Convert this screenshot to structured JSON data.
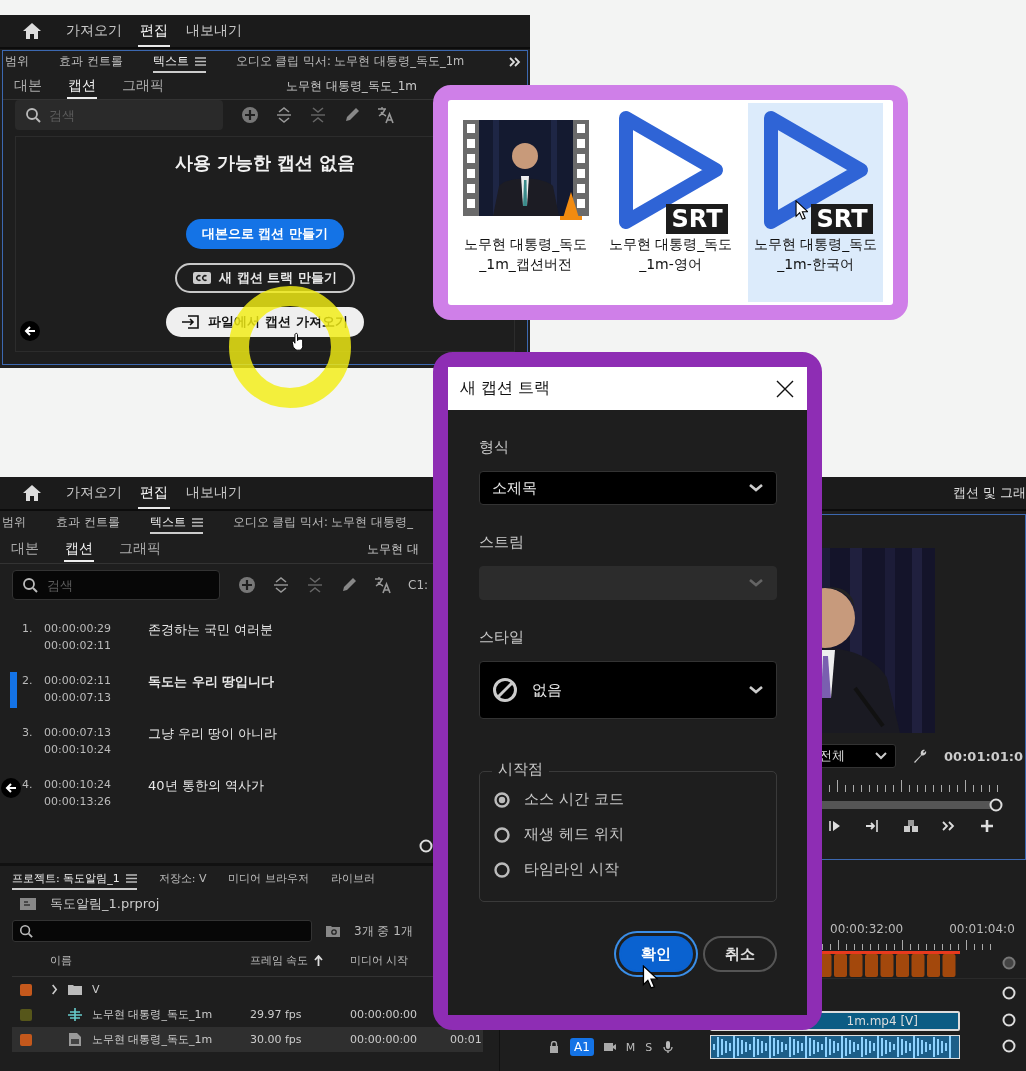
{
  "top_screen": {
    "workspace_tabs": [
      {
        "label": "가져오기",
        "selected": false
      },
      {
        "label": "편집",
        "selected": true
      },
      {
        "label": "내보내기",
        "selected": false
      }
    ],
    "panel_tabs": [
      {
        "label": "범위",
        "selected": false,
        "menu": false
      },
      {
        "label": "효과 컨트롤",
        "selected": false,
        "menu": false
      },
      {
        "label": "텍스트",
        "selected": true,
        "menu": true
      },
      {
        "label": "오디오 클립 믹서: 노무현 대통령_독도_1m",
        "selected": false,
        "menu": false
      }
    ],
    "sub_tabs": [
      {
        "label": "대본",
        "selected": false
      },
      {
        "label": "캡션",
        "selected": true
      },
      {
        "label": "그래픽",
        "selected": false
      }
    ],
    "clip_name": "노무현 대통령_독도_1m",
    "search": {
      "placeholder": "검색"
    },
    "empty_title": "사용 가능한 캡션 없음",
    "buttons": [
      {
        "kind": "primary",
        "label": "대본으로 캡션 만들기"
      },
      {
        "kind": "outline",
        "label": "새 캡션 트랙 만들기"
      },
      {
        "kind": "light",
        "label": "파일에서 캡션 가져오기"
      }
    ]
  },
  "files_panel": {
    "files": [
      {
        "kind": "video",
        "name": "노무현 대통령_독도_1m_캡션버전",
        "selected": false
      },
      {
        "kind": "srt",
        "badge": "SRT",
        "name": "노무현 대통령_독도_1m-영어",
        "selected": false
      },
      {
        "kind": "srt",
        "badge": "SRT",
        "name": "노무현 대통령_독도_1m-한국어",
        "selected": true
      }
    ]
  },
  "bottom_screen": {
    "workspace_tabs": [
      {
        "label": "가져오기",
        "selected": false
      },
      {
        "label": "편집",
        "selected": true
      },
      {
        "label": "내보내기",
        "selected": false
      }
    ],
    "right_title": "캡션 및 그래",
    "panel_tabs": [
      {
        "label": "범위",
        "selected": false,
        "menu": false
      },
      {
        "label": "효과 컨트롤",
        "selected": false,
        "menu": false
      },
      {
        "label": "텍스트",
        "selected": true,
        "menu": true
      },
      {
        "label": "오디오 클립 믹서: 노무현 대통령_",
        "selected": false,
        "menu": false
      }
    ],
    "sub_tabs": [
      {
        "label": "대본",
        "selected": false
      },
      {
        "label": "캡션",
        "selected": true
      },
      {
        "label": "그래픽",
        "selected": false
      }
    ],
    "clip_name": "노무현 대",
    "search": {
      "placeholder": "검색"
    },
    "track_label": "C1:",
    "captions": [
      {
        "index": "1.",
        "start": "00:00:00:29",
        "end": "00:00:02:11",
        "text": "존경하는 국민 여러분",
        "selected": false
      },
      {
        "index": "2.",
        "start": "00:00:02:11",
        "end": "00:00:07:13",
        "text": "독도는 우리 땅입니다",
        "selected": true
      },
      {
        "index": "3.",
        "start": "00:00:07:13",
        "end": "00:00:10:24",
        "text": "그냥 우리 땅이 아니라",
        "selected": false
      },
      {
        "index": "4.",
        "start": "00:00:10:24",
        "end": "00:00:13:26",
        "text": "40년 통한의 역사가",
        "selected": false
      }
    ],
    "project": {
      "tabs": [
        {
          "label": "프로젝트: 독도알림_1",
          "selected": true,
          "menu": true
        },
        {
          "label": "저장소: V",
          "selected": false,
          "menu": false
        },
        {
          "label": "미디어 브라우저",
          "selected": false,
          "menu": false
        },
        {
          "label": "라이브러",
          "selected": false,
          "menu": false
        }
      ],
      "file": "독도알림_1.prproj",
      "item_count": "3개 중 1개",
      "columns": [
        {
          "label": "이름",
          "sorted": false
        },
        {
          "label": "프레임 속도",
          "sorted": true
        },
        {
          "label": "미디어 시작",
          "sorted": false
        }
      ],
      "rows": [
        {
          "kind": "folder",
          "color": "#c4581c",
          "name": "V",
          "expanded": false,
          "selected": false
        },
        {
          "kind": "sequence",
          "color": "#56561a",
          "name": "노무현 대통령_독도_1m",
          "fps": "29.97 fps",
          "start": "00:00:00:00",
          "selected": false
        },
        {
          "kind": "clip",
          "color": "#c4581c",
          "name": "노무현 대통령_독도_1m",
          "fps": "30.00 fps",
          "start": "00:00:00:00",
          "column_4": "00:01",
          "selected": true
        }
      ]
    },
    "monitor": {
      "zoom": "전체",
      "timecode": "00:01:01:0"
    },
    "timeline": {
      "ruler": [
        "00:00:32:00",
        "00:01:04:0"
      ],
      "video_clip": "1m.mp4 [V]",
      "audio_track": {
        "name": "A1",
        "mute": "M",
        "solo": "S"
      }
    }
  },
  "dialog": {
    "title": "새 캡션 트랙",
    "format": {
      "label": "형식",
      "value": "소제목",
      "disabled": false
    },
    "stream": {
      "label": "스트림",
      "disabled": true
    },
    "style": {
      "label": "스타일",
      "value": "없음"
    },
    "start_point": {
      "legend": "시작점",
      "options": [
        {
          "label": "소스 시간 코드",
          "selected": true
        },
        {
          "label": "재생 헤드 위치",
          "selected": false
        },
        {
          "label": "타임라인 시작",
          "selected": false
        }
      ]
    },
    "buttons": [
      {
        "kind": "primary",
        "label": "확인"
      },
      {
        "kind": "secondary",
        "label": "취소"
      }
    ]
  }
}
